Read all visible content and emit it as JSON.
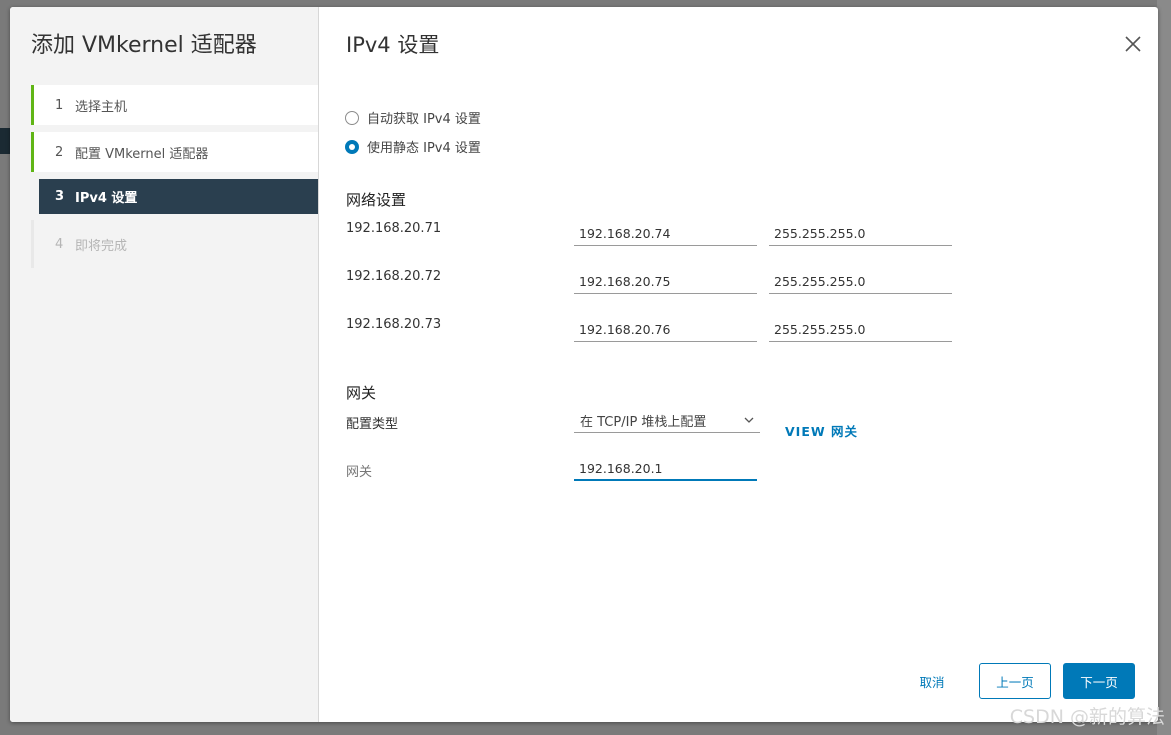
{
  "wizard": {
    "title": "添加 VMkernel 适配器",
    "steps": [
      {
        "num": "1",
        "label": "选择主机"
      },
      {
        "num": "2",
        "label": "配置 VMkernel 适配器"
      },
      {
        "num": "3",
        "label": "IPv4 设置"
      },
      {
        "num": "4",
        "label": "即将完成"
      }
    ]
  },
  "page": {
    "title": "IPv4 设置",
    "radio_auto": "自动获取 IPv4 设置",
    "radio_static": "使用静态 IPv4 设置",
    "selected_radio": "static"
  },
  "network": {
    "section_title": "网络设置",
    "rows": [
      {
        "label": "192.168.20.71",
        "ip": "192.168.20.74",
        "mask": "255.255.255.0"
      },
      {
        "label": "192.168.20.72",
        "ip": "192.168.20.75",
        "mask": "255.255.255.0"
      },
      {
        "label": "192.168.20.73",
        "ip": "192.168.20.76",
        "mask": "255.255.255.0"
      }
    ]
  },
  "gateway": {
    "section_title": "网关",
    "config_type_label": "配置类型",
    "config_type_value": "在 TCP/IP 堆栈上配置",
    "view_link": "VIEW 网关",
    "gateway_label": "网关",
    "gateway_value": "192.168.20.1"
  },
  "footer": {
    "cancel": "取消",
    "prev": "上一页",
    "next": "下一页"
  },
  "colors": {
    "accent": "#0079b8",
    "step_done": "#60b515",
    "step_active_bg": "#2a3f4f"
  },
  "watermark": "CSDN @新的算法"
}
